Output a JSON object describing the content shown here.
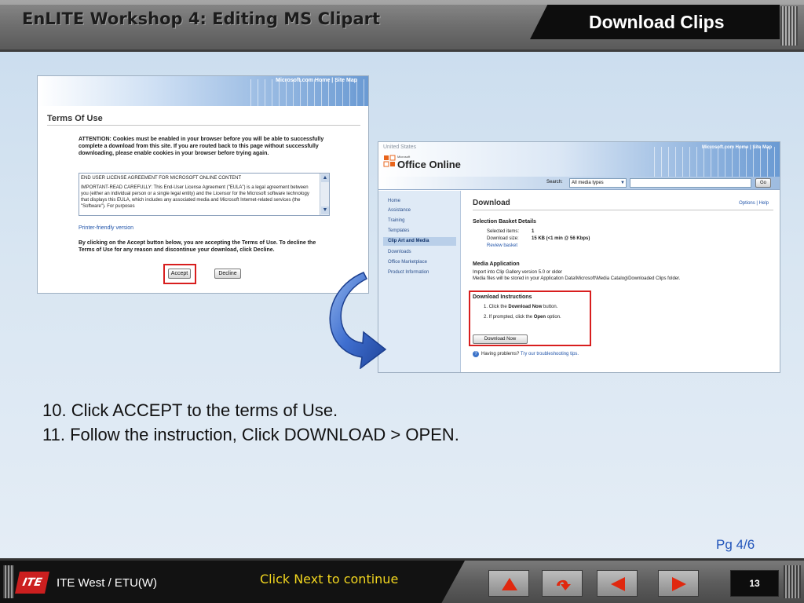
{
  "header": {
    "workshop_title": "EnLITE Workshop 4: Editing MS Clipart",
    "section_title": "Download Clips"
  },
  "terms_window": {
    "ms_links": "Microsoft.com Home  |  Site Map",
    "heading": "Terms Of Use",
    "attention": "ATTENTION: Cookies must be enabled in your browser before you will be able to successfully complete a download from this site. If you are routed back to this page without successfully downloading, please enable cookies in your browser before trying again.",
    "eula_title": "END USER LICENSE AGREEMENT FOR MICROSOFT ONLINE CONTENT",
    "eula_body": "IMPORTANT-READ CAREFULLY: This End-User License Agreement (\"EULA\") is a legal agreement between you (either an individual person or a single legal entity) and the Licensor for the Microsoft software technology that displays this EULA, which includes any associated media and Microsoft Internet-related services (the \"Software\"). For purposes",
    "printer_link": "Printer-friendly version",
    "decline_text": "By clicking on the Accept button below, you are accepting the Terms of Use. To decline the Terms of Use for any reason and discontinue your download, click Decline.",
    "accept_label": "Accept",
    "decline_label": "Decline"
  },
  "office_window": {
    "region": "United States",
    "ms_links": "Microsoft.com Home  |  Site Map",
    "logo_microsoft": "Microsoft",
    "logo_office": "Office Online",
    "search_label": "Search:",
    "search_select": "All media types",
    "go_label": "Go",
    "nav": [
      "Home",
      "Assistance",
      "Training",
      "Templates",
      "Clip Art and Media",
      "Downloads",
      "Office Marketplace",
      "Product Information"
    ],
    "download_heading": "Download",
    "options_help": "Options | Help",
    "basket_heading": "Selection Basket Details",
    "selected_items_label": "Selected items:",
    "selected_items_value": "1",
    "download_size_label": "Download size:",
    "download_size_value": "15 KB  (<1 min @ 56 Kbps)",
    "review_link": "Review basket",
    "media_heading": "Media Application",
    "media_line1": "Import into Clip Gallery version 5.0 or older",
    "media_line2": "Media files will be stored in your Application Data\\Microsoft\\Media Catalog\\Downloaded Clips folder.",
    "instr_heading": "Download Instructions",
    "step1_prefix": "1.   Click the ",
    "step1_bold": "Download Now",
    "step1_suffix": " button.",
    "step2_prefix": "2.   If prompted, click the ",
    "step2_bold": "Open",
    "step2_suffix": " option.",
    "download_now_label": "Download Now",
    "help_prefix": "Having problems? ",
    "help_link": "Try our troubleshooting tips."
  },
  "instructions": {
    "step10": "10. Click ACCEPT to the terms of Use.",
    "step11": "11. Follow the instruction, Click DOWNLOAD > OPEN."
  },
  "page_indicator": "Pg 4/6",
  "footer": {
    "logo_text": "ITE",
    "org_name": "ITE  West / ETU(W)",
    "next_hint": "Click Next to continue",
    "slide_number": "13"
  },
  "colors": {
    "highlight_red": "#d81e1e",
    "link_blue": "#2255aa",
    "footer_hint_yellow": "#f1d51f",
    "logo_red": "#cc1f1f"
  },
  "icons": {
    "curve_arrow": "curved-arrow-icon",
    "nav_first": "triangle-up-icon",
    "nav_return": "return-arrow-icon",
    "nav_prev": "triangle-left-icon",
    "nav_next": "triangle-right-icon"
  }
}
